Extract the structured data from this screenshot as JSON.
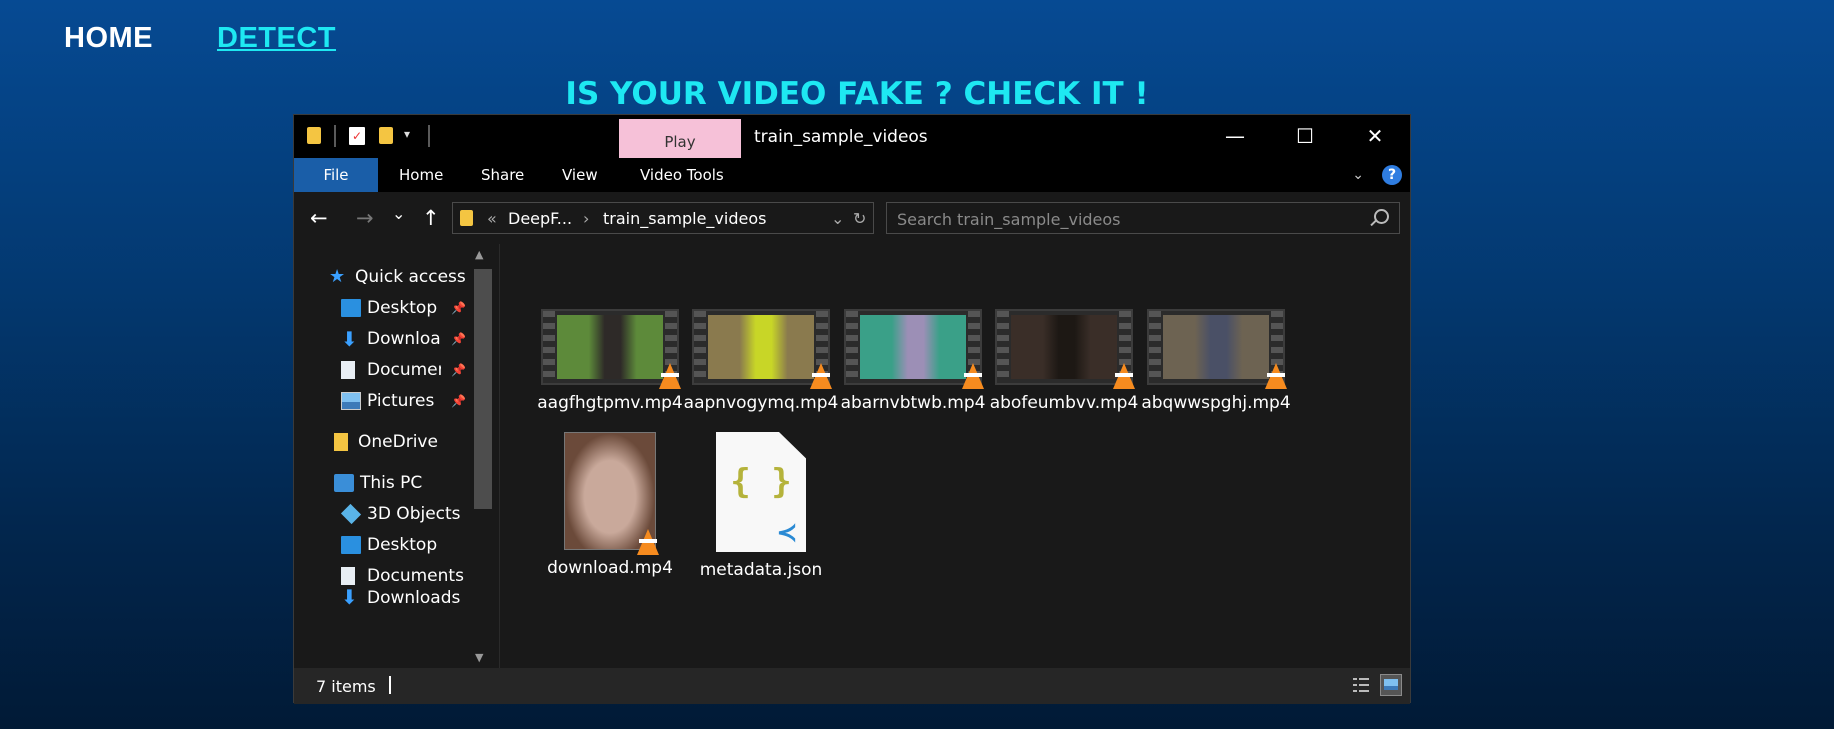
{
  "site": {
    "nav": {
      "home": "HOME",
      "detect": "DETECT"
    },
    "headline": "IS YOUR VIDEO FAKE ? CHECK IT !"
  },
  "explorer": {
    "contextual_tab": "Play",
    "title": "train_sample_videos",
    "window_controls": {
      "minimize": "—",
      "maximize": "☐",
      "close": "✕"
    },
    "ribbon": {
      "file": "File",
      "home": "Home",
      "share": "Share",
      "view": "View",
      "video_tools": "Video Tools"
    },
    "help_label": "?",
    "nav_buttons": {
      "back": "←",
      "forward": "→",
      "recent": "⌄",
      "up": "↑"
    },
    "address": {
      "overflow": "«",
      "parent": "DeepF...",
      "separator": "›",
      "current": "train_sample_videos",
      "dropdown": "⌄",
      "refresh": "↻"
    },
    "search": {
      "placeholder": "Search train_sample_videos"
    },
    "tree": {
      "quick_access": "Quick access",
      "desktop_pinned": "Desktop",
      "downloads_pinned": "Downloads",
      "documents_pinned": "Documents",
      "pictures_pinned": "Pictures",
      "onedrive": "OneDrive",
      "this_pc": "This PC",
      "objects_3d": "3D Objects",
      "desktop": "Desktop",
      "documents": "Documents",
      "downloads": "Downloads"
    },
    "files": [
      {
        "name": "aagfhgtpmv.mp4",
        "type": "video",
        "thumb_bg": "#5d8a3a",
        "thumb_fg": "#2e2a28"
      },
      {
        "name": "aapnvogymq.mp4",
        "type": "video",
        "thumb_bg": "#8a7a4e",
        "thumb_fg": "#c8d627"
      },
      {
        "name": "abarnvbtwb.mp4",
        "type": "video",
        "thumb_bg": "#3aa088",
        "thumb_fg": "#9c8fb6"
      },
      {
        "name": "abofeumbvv.mp4",
        "type": "video",
        "thumb_bg": "#3a2e28",
        "thumb_fg": "#1d1814"
      },
      {
        "name": "abqwwspghj.mp4",
        "type": "video",
        "thumb_bg": "#6d6352",
        "thumb_fg": "#4a5066"
      },
      {
        "name": "download.mp4",
        "type": "video",
        "thumb_bg": "#c9a99b",
        "thumb_fg": "#6b4a3a"
      },
      {
        "name": "metadata.json",
        "type": "json",
        "glyph": "{ }"
      }
    ],
    "status": {
      "item_count": "7 items"
    },
    "colors": {
      "accent": "#1a5ea8",
      "play_tab": "#f6c1d8",
      "vlc_cone": "#f68b1f",
      "json_braces": "#b5b33b",
      "vscode_blue": "#2a8ad4"
    }
  }
}
